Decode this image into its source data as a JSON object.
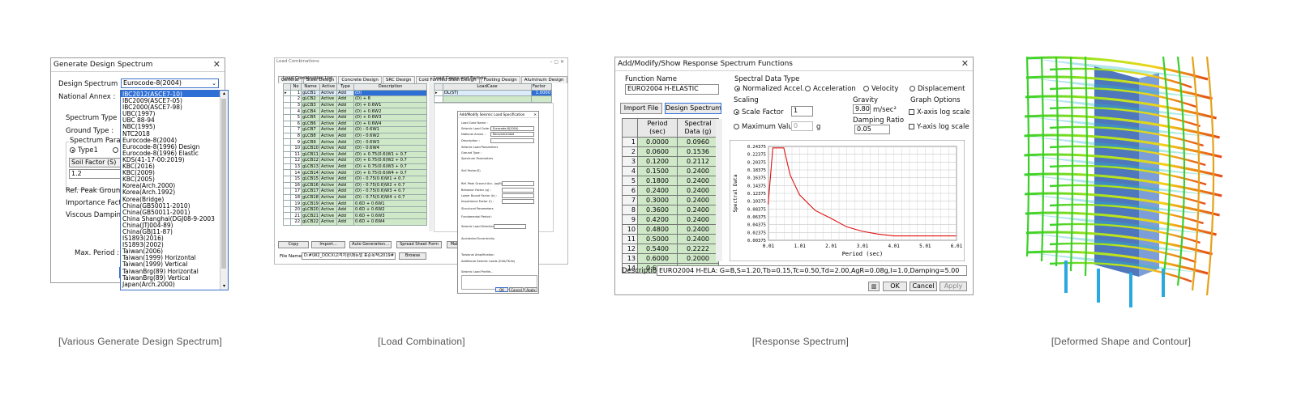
{
  "captions": [
    "[Various Generate Design Spectrum]",
    "[Load Combination]",
    "[Response Spectrum]",
    "[Deformed Shape and Contour]"
  ],
  "design_spectrum": {
    "title": "Generate Design Spectrum",
    "design_spectrum_label": "Design Spectrum :",
    "design_spectrum_value": "Eurocode-8(2004)",
    "national_annex_label": "National Annex :",
    "spectrum_type_label": "Spectrum Type :",
    "ground_type_label": "Ground Type :",
    "spectrum_param_label": "Spectrum Param",
    "type1_label": "Type1",
    "soil_factor_label": "Soil Factor (S)",
    "soil_factor_value": "1.2",
    "ref_peak_label": "Ref. Peak Ground",
    "importance_label": "Importance Facto",
    "viscous_label": "Viscous Damping",
    "max_period_label": "Max. Period :",
    "options": [
      "IBC2012(ASCE7-10)",
      "IBC2009(ASCE7-05)",
      "IBC2000(ASCE7-98)",
      "UBC(1997)",
      "UBC 88-94",
      "NBC(1995)",
      "NTC2018",
      "Eurocode-8(2004)",
      "Eurocode-8(1996) Design",
      "Eurocode-8(1996) Elastic",
      "KDS(41-17-00:2019)",
      "KBC(2016)",
      "KBC(2009)",
      "KBC(2005)",
      "Korea(Arch.2000)",
      "Korea(Arch.1992)",
      "Korea(Bridge)",
      "China(GB50011-2010)",
      "China(GB50011-2001)",
      "China Shanghai(DGJ08-9-2003",
      "China(JTJ004-89)",
      "China(GBJ11-87)",
      "IS1893(2016)",
      "IS1893(2002)",
      "Taiwan(2006)",
      "Taiwan(1999) Horizontal",
      "Taiwan(1999) Vertical",
      "TaiwanBrg(89) Horizontal",
      "TaiwanBrg(89) Vertical",
      "Japan(Arch.2000)"
    ],
    "selected_option": "IBC2012(ASCE7-10)"
  },
  "load_combination": {
    "title": "Load Combinations",
    "tabs": [
      "General",
      "Steel Design",
      "Concrete Design",
      "SRC Design",
      "Cold Formed Steel Design",
      "Footing Design",
      "Aluminum Design"
    ],
    "list_title": "Load Combination List",
    "headers": [
      "No",
      "Name",
      "Active",
      "Type",
      "Description"
    ],
    "rows": [
      [
        "1",
        "gLCB1",
        "Active",
        "Add",
        "(D)"
      ],
      [
        "2",
        "gLCB2",
        "Active",
        "Add",
        "(D) + 8"
      ],
      [
        "3",
        "gLCB3",
        "Active",
        "Add",
        "(D) + 0.6W1"
      ],
      [
        "4",
        "gLCB4",
        "Active",
        "Add",
        "(D) + 0.6W2"
      ],
      [
        "5",
        "gLCB5",
        "Active",
        "Add",
        "(D) + 0.6W3"
      ],
      [
        "6",
        "gLCB6",
        "Active",
        "Add",
        "(D) + 0.6W4"
      ],
      [
        "7",
        "gLCB7",
        "Active",
        "Add",
        "(D) - 0.6W1"
      ],
      [
        "8",
        "gLCB8",
        "Active",
        "Add",
        "(D) - 0.6W2"
      ],
      [
        "9",
        "gLCB9",
        "Active",
        "Add",
        "(D) - 0.6W3"
      ],
      [
        "10",
        "gLCB10",
        "Active",
        "Add",
        "(D) - 0.6W4"
      ],
      [
        "11",
        "gLCB11",
        "Active",
        "Add",
        "(D) + 0.75(0.6)W1 + 0.7"
      ],
      [
        "12",
        "gLCB12",
        "Active",
        "Add",
        "(D) + 0.75(0.6)W2 + 0.7"
      ],
      [
        "13",
        "gLCB13",
        "Active",
        "Add",
        "(D) + 0.75(0.6)W3 + 0.7"
      ],
      [
        "14",
        "gLCB14",
        "Active",
        "Add",
        "(D) + 0.75(0.6)W4 + 0.7"
      ],
      [
        "15",
        "gLCB15",
        "Active",
        "Add",
        "(D) - 0.75(0.6)W1 + 0.7"
      ],
      [
        "16",
        "gLCB16",
        "Active",
        "Add",
        "(D) - 0.75(0.6)W2 + 0.7"
      ],
      [
        "17",
        "gLCB17",
        "Active",
        "Add",
        "(D) - 0.75(0.6)W3 + 0.7"
      ],
      [
        "18",
        "gLCB18",
        "Active",
        "Add",
        "(D) - 0.75(0.6)W4 + 0.7"
      ],
      [
        "19",
        "gLCB19",
        "Active",
        "Add",
        "0.6D + 0.6W1"
      ],
      [
        "20",
        "gLCB20",
        "Active",
        "Add",
        "0.6D + 0.6W2"
      ],
      [
        "21",
        "gLCB21",
        "Active",
        "Add",
        "0.6D + 0.6W3"
      ],
      [
        "22",
        "gLCB22",
        "Active",
        "Add",
        "0.6D + 0.6W4"
      ]
    ],
    "cases_title": "Load Cases and Factors",
    "cases_headers": [
      "LoadCase",
      "Factor"
    ],
    "case_row": [
      "DL(ST)",
      "1.0000"
    ],
    "buttons": [
      "Copy",
      "Import...",
      "Auto Generation...",
      "Spread Sheet Form",
      "Make Lo"
    ],
    "file_name_label": "File Name:",
    "file_name_value": "D:#\\W2_DOCX\\고객지원\\매뉴얼 표준목적\\2019#",
    "browse_label": "Browse",
    "sub_title": "Add/Modify Seismic Load Specification",
    "sub_lines": [
      "Load Case Name :",
      "Seismic Load Code :",
      "National Annex :",
      "Description :",
      "Seismic Load Parameters",
      "Ground Type :",
      "Spectrum Parameters",
      "Soil Factor(S)",
      "Ref. Peak Ground Acc. (agR) :",
      "Behavior Factor (q) :",
      "Lower Bound Factor (b) :",
      "Importance Factor (I) :",
      "Structural Parameters",
      "Fundamental Period :",
      "Seismic Load Direction Factor (Scale Factor)",
      "Accidental Eccentricity",
      "Torsional Amplification",
      "Additional Seismic Loads (EXA/TK-tb)",
      "Seismic Load Profile..."
    ],
    "sub_code_value": "Eurocode-8(2004)",
    "sub_annex_value": "Recommended",
    "sub_buttons": [
      "OK",
      "Cancel",
      "Apply"
    ]
  },
  "response_spectrum": {
    "title": "Add/Modify/Show Response Spectrum Functions",
    "function_name_label": "Function Name",
    "function_name_value": "EURO2004 H-ELASTIC",
    "import_button": "Import File",
    "design_button": "Design Spectrum",
    "period_header": "Period (sec)",
    "spectral_header": "Spectral Data (g)",
    "rows": [
      [
        "1",
        "0.0000",
        "0.0960"
      ],
      [
        "2",
        "0.0600",
        "0.1536"
      ],
      [
        "3",
        "0.1200",
        "0.2112"
      ],
      [
        "4",
        "0.1500",
        "0.2400"
      ],
      [
        "5",
        "0.1800",
        "0.2400"
      ],
      [
        "6",
        "0.2400",
        "0.2400"
      ],
      [
        "7",
        "0.3000",
        "0.2400"
      ],
      [
        "8",
        "0.3600",
        "0.2400"
      ],
      [
        "9",
        "0.4200",
        "0.2400"
      ],
      [
        "10",
        "0.4800",
        "0.2400"
      ],
      [
        "11",
        "0.5000",
        "0.2400"
      ],
      [
        "12",
        "0.5400",
        "0.2222"
      ],
      [
        "13",
        "0.6000",
        "0.2000"
      ],
      [
        "14",
        "0.6600",
        "0.1818"
      ]
    ],
    "spectral_data_type_label": "Spectral Data Type",
    "type_options": [
      "Normalized Accel.",
      "Acceleration",
      "Velocity",
      "Displacement"
    ],
    "scaling_label": "Scaling",
    "scale_factor_label": "Scale Factor",
    "scale_factor_value": "1",
    "max_value_label": "Maximum Value",
    "max_value_value": "0",
    "max_value_unit": "g",
    "gravity_label": "Gravity",
    "gravity_value": "9.806",
    "gravity_unit": "m/sec²",
    "damping_label": "Damping Ratio",
    "damping_value": "0.05",
    "graph_options_label": "Graph Options",
    "x_log_label": "X-axis log scale",
    "y_log_label": "Y-axis log scale",
    "description_label": "Description",
    "description_value": "EURO2004 H-ELA: G=B,S=1.20,Tb=0.15,Tc=0.50,Td=2.00,AgR=0.08g,I=1.0,Damping=5.00",
    "buttons": [
      "OK",
      "Cancel",
      "Apply"
    ],
    "series_color": "#e01010"
  },
  "chart_data": {
    "type": "line",
    "xlabel": "Period (sec)",
    "ylabel": "Spectral Data",
    "xlim": [
      0.01,
      6.01
    ],
    "ylim": [
      0.00375,
      0.24375
    ],
    "x_ticks": [
      "0.01",
      "1.01",
      "2.01",
      "3.01",
      "4.01",
      "5.01",
      "6.01"
    ],
    "y_ticks": [
      "0.00375",
      "0.02375",
      "0.04375",
      "0.06375",
      "0.08375",
      "0.10375",
      "0.12375",
      "0.14375",
      "0.16375",
      "0.18375",
      "0.20375",
      "0.22375",
      "0.24375"
    ],
    "series": [
      {
        "x": [
          0.0,
          0.15,
          0.5,
          0.7,
          1.0,
          1.5,
          2.0,
          2.5,
          3.0,
          3.5,
          4.0,
          4.5,
          5.0,
          5.5,
          6.0
        ],
        "y": [
          0.096,
          0.24,
          0.24,
          0.171,
          0.12,
          0.08,
          0.06,
          0.0384,
          0.0267,
          0.0196,
          0.015,
          0.015,
          0.015,
          0.015,
          0.015
        ]
      }
    ]
  }
}
